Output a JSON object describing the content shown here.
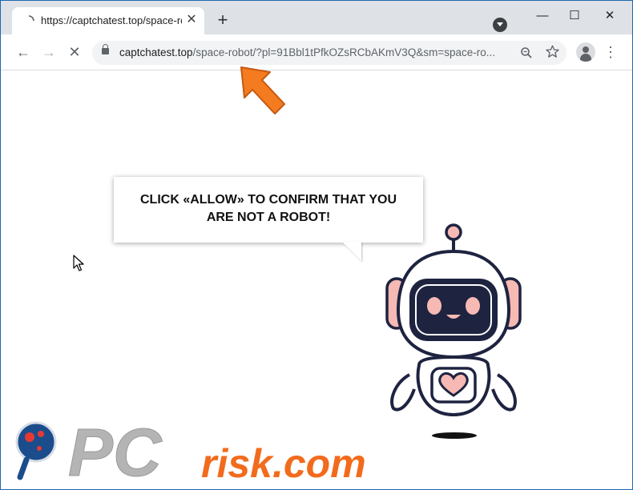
{
  "browser": {
    "tab_title": "https://captchatest.top/space-rol",
    "new_tab_symbol": "+",
    "tab_close_symbol": "✕",
    "window_controls": {
      "minimize": "—",
      "maximize": "☐",
      "close": "✕"
    },
    "nav": {
      "back": "←",
      "forward": "→",
      "stop": "✕"
    },
    "url_domain": "captchatest.top",
    "url_path": "/space-robot/?pl=91Bbl1tPfkOZsRCbAKmV3Q&sm=space-ro...",
    "menu_symbol": "⋮"
  },
  "page": {
    "message": "CLICK «ALLOW» TO CONFIRM THAT YOU ARE NOT A ROBOT!"
  },
  "watermark": {
    "logo_text": "PC",
    "domain_text": "risk.com"
  },
  "icons": [
    "loading-spinner-icon",
    "tab-close-icon",
    "new-tab-icon",
    "tab-search-icon",
    "minimize-icon",
    "maximize-icon",
    "window-close-icon",
    "back-arrow-icon",
    "forward-arrow-icon",
    "stop-icon",
    "lock-icon",
    "zoom-icon",
    "bookmark-star-icon",
    "profile-avatar-icon",
    "more-menu-icon",
    "mouse-cursor-icon",
    "orange-pointer-arrow-icon",
    "robot-illustration"
  ],
  "colors": {
    "window_border": "#1f67b1",
    "tabbar_bg": "#dee1e6",
    "arrow_orange": "#f47b20",
    "robot_outline": "#1e2340",
    "robot_pink": "#f7b9b4",
    "watermark_gray": "#b4b4b4",
    "watermark_orange": "#f26b1d",
    "watermark_blue": "#1b4d8c"
  }
}
